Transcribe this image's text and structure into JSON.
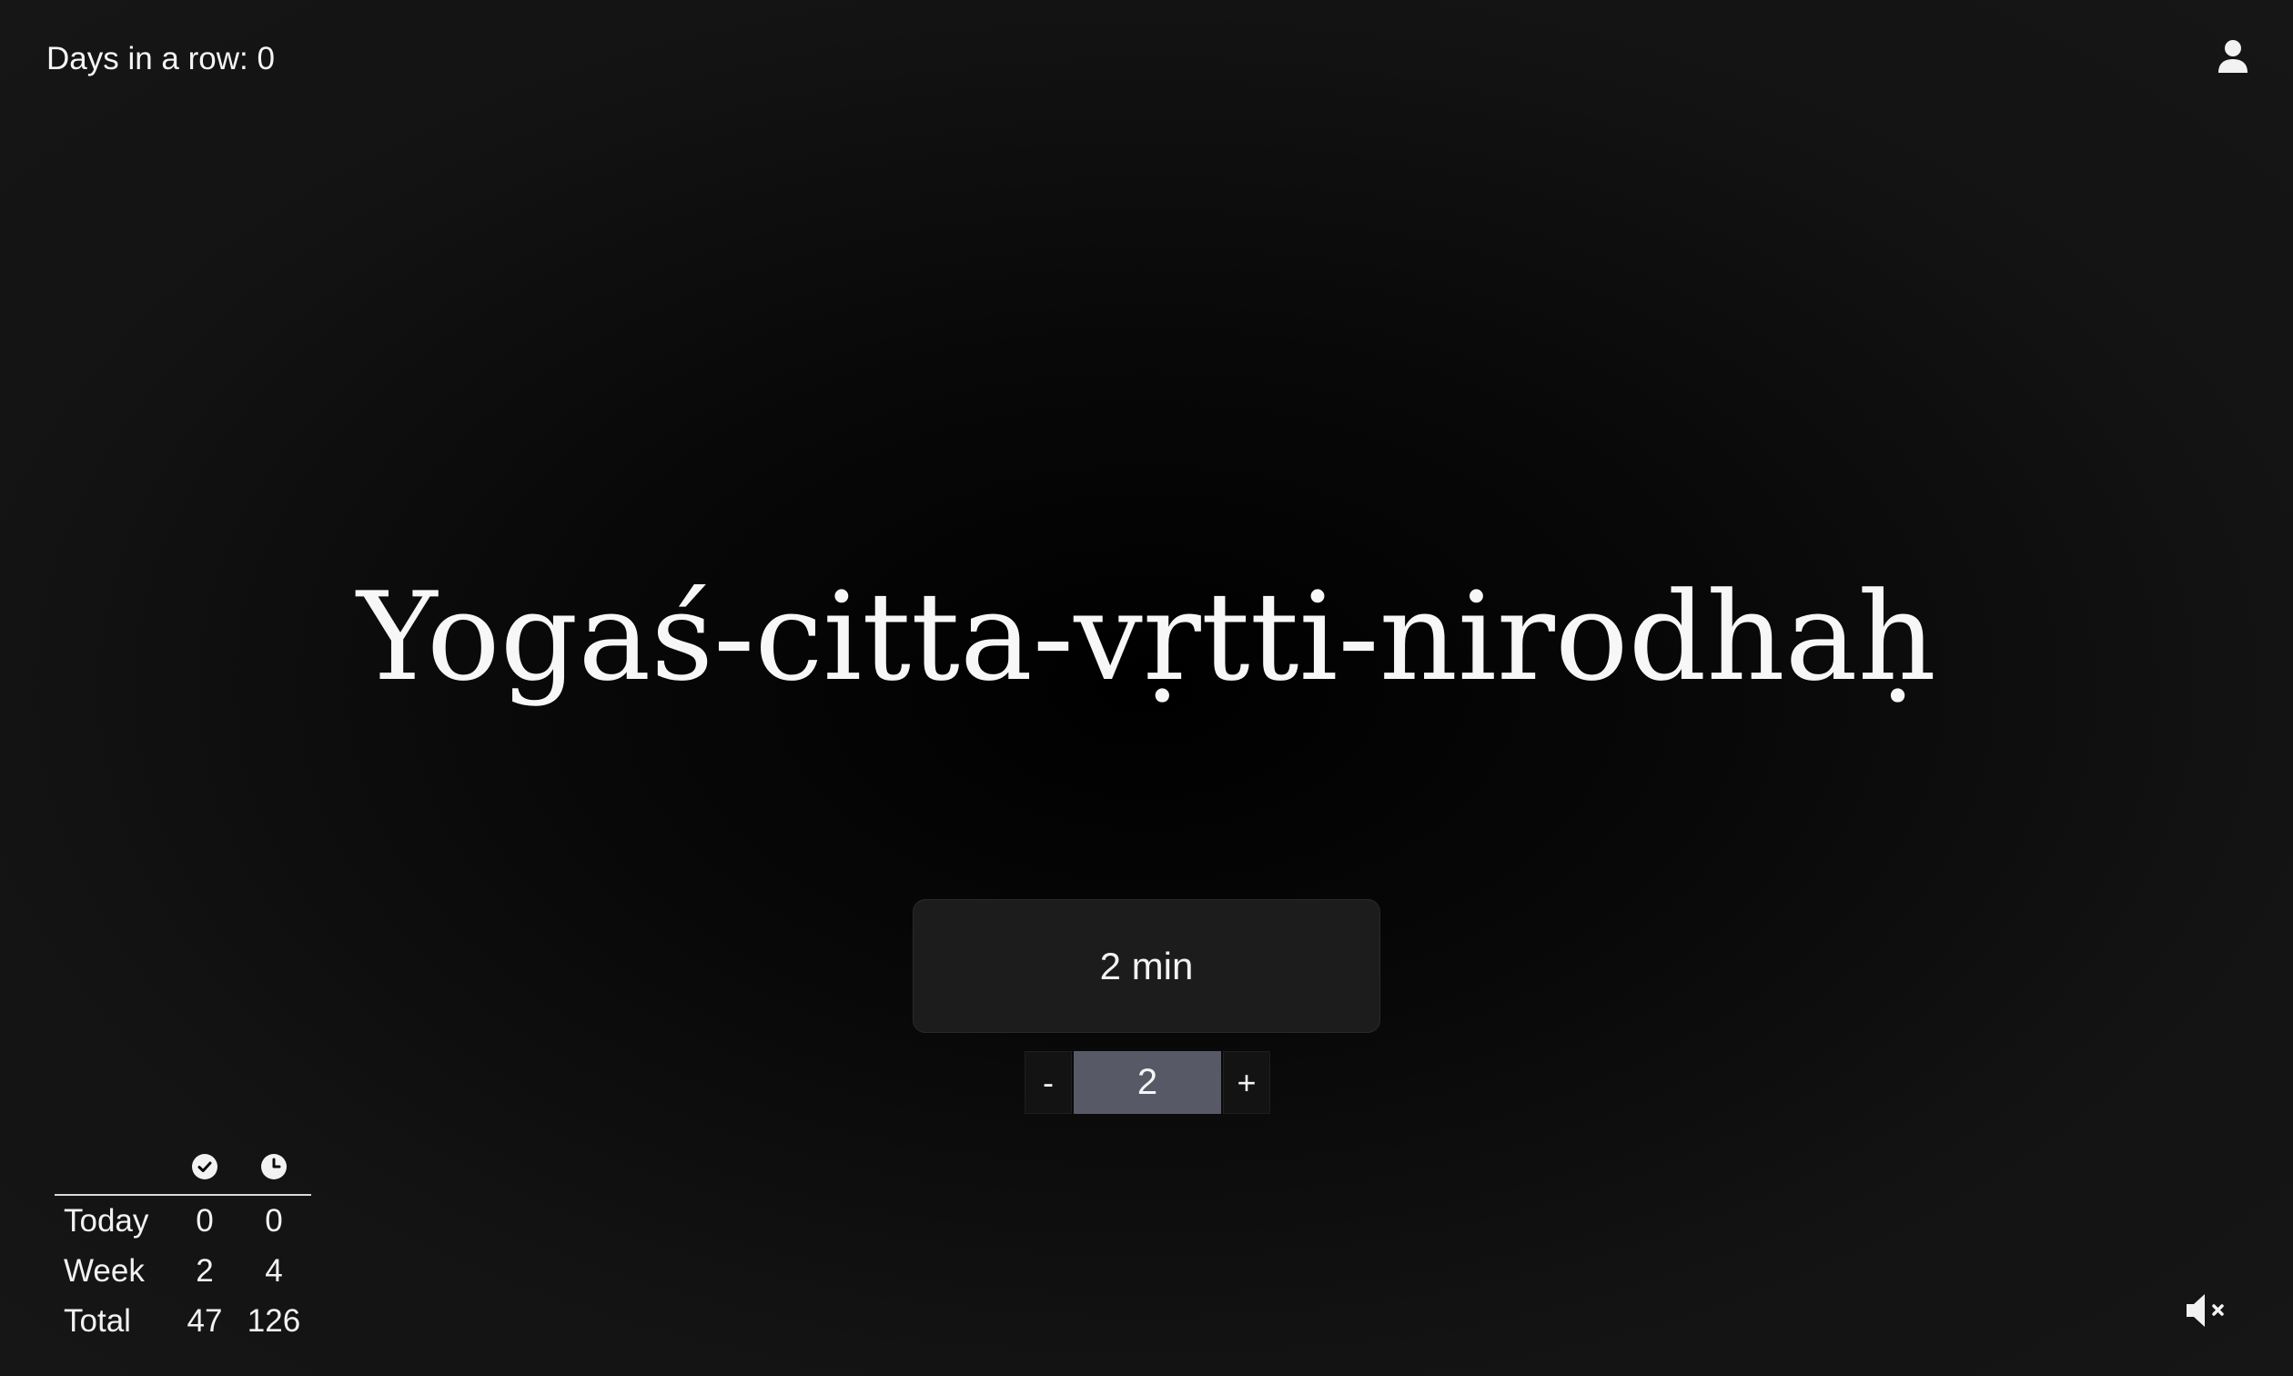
{
  "streak": {
    "label": "Days in a row:",
    "value": "0"
  },
  "icons": {
    "profile": "user-icon",
    "sessions_column": "check-circle-icon",
    "minutes_column": "clock-icon",
    "sound": "speaker-muted-icon"
  },
  "mantra": {
    "text": "Yogaś-citta-vṛtti-nirodhaḥ"
  },
  "timer": {
    "minutes": "2",
    "unit": "min"
  },
  "stepper": {
    "decrement_label": "-",
    "value": "2",
    "increment_label": "+"
  },
  "stats": {
    "rows": [
      {
        "label": "Today",
        "sessions": "0",
        "minutes": "0"
      },
      {
        "label": "Week",
        "sessions": "2",
        "minutes": "4"
      },
      {
        "label": "Total",
        "sessions": "47",
        "minutes": "126"
      }
    ]
  },
  "colors": {
    "background": "#000000",
    "text": "#f2f2f2",
    "button": "#1c1c1c",
    "stepper_value": "#575966"
  }
}
